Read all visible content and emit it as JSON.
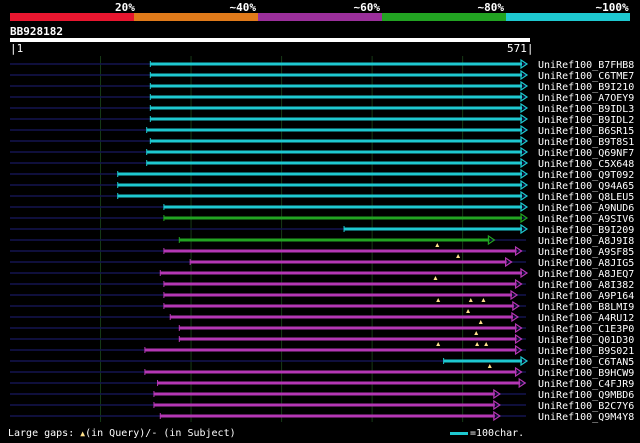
{
  "legend": {
    "labels": [
      "20%",
      "~40%",
      "~60%",
      "~80%",
      "~100%"
    ],
    "colors": [
      "#e8162f",
      "#e07a1a",
      "#9b2f9b",
      "#22a322",
      "#1ec8d0"
    ]
  },
  "query": {
    "id": "BB928182",
    "start": "1",
    "end": "571"
  },
  "colors": {
    "cyan": "#1ec8d0",
    "green": "#22a322",
    "magenta": "#b537b5",
    "navy": "#141450",
    "grid": "#163a16"
  },
  "hits": [
    {
      "name": "UniRef100_B7FHB8",
      "color": "cyan",
      "start": 156,
      "end": 571,
      "gaps_q": []
    },
    {
      "name": "UniRef100_C6TME7",
      "color": "cyan",
      "start": 156,
      "end": 571,
      "gaps_q": []
    },
    {
      "name": "UniRef100_B9I210",
      "color": "cyan",
      "start": 156,
      "end": 571,
      "gaps_q": []
    },
    {
      "name": "UniRef100_A7OEY9",
      "color": "cyan",
      "start": 156,
      "end": 571,
      "gaps_q": []
    },
    {
      "name": "UniRef100_B9IDL3",
      "color": "cyan",
      "start": 156,
      "end": 571,
      "gaps_q": []
    },
    {
      "name": "UniRef100_B9IDL2",
      "color": "cyan",
      "start": 156,
      "end": 571,
      "gaps_q": []
    },
    {
      "name": "UniRef100_B6SR15",
      "color": "cyan",
      "start": 152,
      "end": 571,
      "gaps_q": []
    },
    {
      "name": "UniRef100_B9T8S1",
      "color": "cyan",
      "start": 156,
      "end": 571,
      "gaps_q": []
    },
    {
      "name": "UniRef100_Q69NF7",
      "color": "cyan",
      "start": 152,
      "end": 571,
      "gaps_q": []
    },
    {
      "name": "UniRef100_C5X648",
      "color": "cyan",
      "start": 152,
      "end": 571,
      "gaps_q": []
    },
    {
      "name": "UniRef100_Q9T092",
      "color": "cyan",
      "start": 120,
      "end": 571,
      "gaps_q": []
    },
    {
      "name": "UniRef100_Q94A65",
      "color": "cyan",
      "start": 120,
      "end": 571,
      "gaps_q": []
    },
    {
      "name": "UniRef100_Q8LEU5",
      "color": "cyan",
      "start": 120,
      "end": 571,
      "gaps_q": []
    },
    {
      "name": "UniRef100_A9NUD6",
      "color": "cyan",
      "start": 171,
      "end": 571,
      "gaps_q": []
    },
    {
      "name": "UniRef100_A9SIV6",
      "color": "green",
      "start": 171,
      "end": 571,
      "gaps_q": []
    },
    {
      "name": "UniRef100_B9I209",
      "color": "cyan",
      "start": 370,
      "end": 571,
      "gaps_q": []
    },
    {
      "name": "UniRef100_A8J9I8",
      "color": "green",
      "start": 188,
      "end": 535,
      "gaps_q": []
    },
    {
      "name": "UniRef100_A9SF85",
      "color": "magenta",
      "start": 171,
      "end": 565,
      "gaps_q": [
        473
      ]
    },
    {
      "name": "UniRef100_A8JIG5",
      "color": "magenta",
      "start": 200,
      "end": 554,
      "gaps_q": [
        496
      ]
    },
    {
      "name": "UniRef100_A8JEQ7",
      "color": "magenta",
      "start": 167,
      "end": 571,
      "gaps_q": []
    },
    {
      "name": "UniRef100_A8I382",
      "color": "magenta",
      "start": 171,
      "end": 565,
      "gaps_q": [
        471
      ]
    },
    {
      "name": "UniRef100_A9P164",
      "color": "magenta",
      "start": 171,
      "end": 560,
      "gaps_q": []
    },
    {
      "name": "UniRef100_B8LMI9",
      "color": "magenta",
      "start": 171,
      "end": 562,
      "gaps_q": [
        474,
        510,
        524
      ]
    },
    {
      "name": "UniRef100_A4RU12",
      "color": "magenta",
      "start": 178,
      "end": 561,
      "gaps_q": [
        507
      ]
    },
    {
      "name": "UniRef100_C1E3P0",
      "color": "magenta",
      "start": 188,
      "end": 565,
      "gaps_q": [
        521
      ]
    },
    {
      "name": "UniRef100_Q01D30",
      "color": "magenta",
      "start": 188,
      "end": 565,
      "gaps_q": [
        516
      ]
    },
    {
      "name": "UniRef100_B9S021",
      "color": "magenta",
      "start": 150,
      "end": 565,
      "gaps_q": [
        474,
        517,
        527
      ]
    },
    {
      "name": "UniRef100_C6TAN5",
      "color": "cyan",
      "start": 480,
      "end": 571,
      "gaps_q": []
    },
    {
      "name": "UniRef100_B9HCW9",
      "color": "magenta",
      "start": 150,
      "end": 565,
      "gaps_q": [
        531
      ]
    },
    {
      "name": "UniRef100_C4FJR9",
      "color": "magenta",
      "start": 164,
      "end": 569,
      "gaps_q": []
    },
    {
      "name": "UniRef100_Q9MBD6",
      "color": "magenta",
      "start": 160,
      "end": 541,
      "gaps_q": []
    },
    {
      "name": "UniRef100_B2C7Y6",
      "color": "magenta",
      "start": 160,
      "end": 541,
      "gaps_q": []
    },
    {
      "name": "UniRef100_Q9M4Y8",
      "color": "magenta",
      "start": 167,
      "end": 541,
      "gaps_q": []
    }
  ],
  "footer": {
    "left_prefix": "Large gaps:",
    "left_glyph": "▲",
    "left_rest": "(in Query)/- (in Subject)",
    "right": "=100char."
  }
}
